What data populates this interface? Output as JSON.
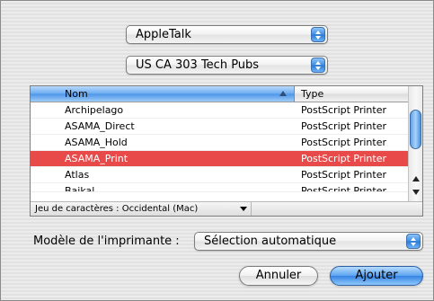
{
  "protocol_popup": {
    "value": "AppleTalk"
  },
  "zone_popup": {
    "value": "US CA 303 Tech Pubs"
  },
  "printer_list": {
    "columns": [
      "Nom",
      "Type"
    ],
    "rows": [
      {
        "name": "Archipelago",
        "type": "PostScript Printer",
        "selected": false
      },
      {
        "name": "ASAMA_Direct",
        "type": "PostScript Printer",
        "selected": false
      },
      {
        "name": "ASAMA_Hold",
        "type": "PostScript Printer",
        "selected": false
      },
      {
        "name": "ASAMA_Print",
        "type": "PostScript Printer",
        "selected": true
      },
      {
        "name": "Atlas",
        "type": "PostScript Printer",
        "selected": false
      },
      {
        "name": "Baikal",
        "type": "PostScript Printer",
        "selected": false
      }
    ],
    "charset_label": "Jeu de caractères : Occidental (Mac)"
  },
  "printer_model": {
    "label": "Modèle de l'imprimante :",
    "value": "Sélection automatique"
  },
  "buttons": {
    "cancel": "Annuler",
    "add": "Ajouter"
  },
  "colors": {
    "selection": "#e84a4a",
    "accent_blue": "#3583e4"
  }
}
